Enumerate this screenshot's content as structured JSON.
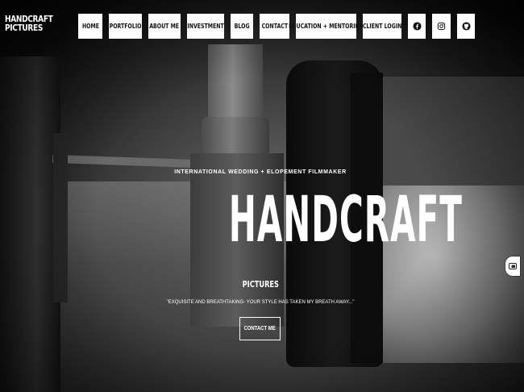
{
  "brand": {
    "line1": "HANDCRAFT",
    "line2": "PICTURES"
  },
  "nav": {
    "items": [
      {
        "label": "HOME"
      },
      {
        "label": "PORTFOLIO"
      },
      {
        "label": "ABOUT ME"
      },
      {
        "label": "INVESTMENT"
      },
      {
        "label": "BLOG"
      },
      {
        "label": "CONTACT"
      },
      {
        "label": "EDUCATION + MENTORING"
      },
      {
        "label": "CLIENT LOGIN"
      }
    ],
    "social": [
      {
        "icon": "facebook-icon"
      },
      {
        "icon": "instagram-icon"
      },
      {
        "icon": "github-icon"
      }
    ]
  },
  "hero": {
    "eyebrow": "INTERNATIONAL WEDDING + ELOPEMENT FILMMAKER",
    "headline": "HANDCRAFT",
    "subhead": "PICTURES",
    "quote": "\"EXQUISITE AND BREATHTAKING- YOUR STYLE HAS TAKEN MY BREATH AWAY...\"",
    "cta_label": "CONTACT ME"
  },
  "widget": {
    "icon": "screenshot-capture-icon"
  },
  "colors": {
    "background": "#000000",
    "button_bg": "#ffffff",
    "button_text": "#111111",
    "hero_text": "#ffffff"
  }
}
